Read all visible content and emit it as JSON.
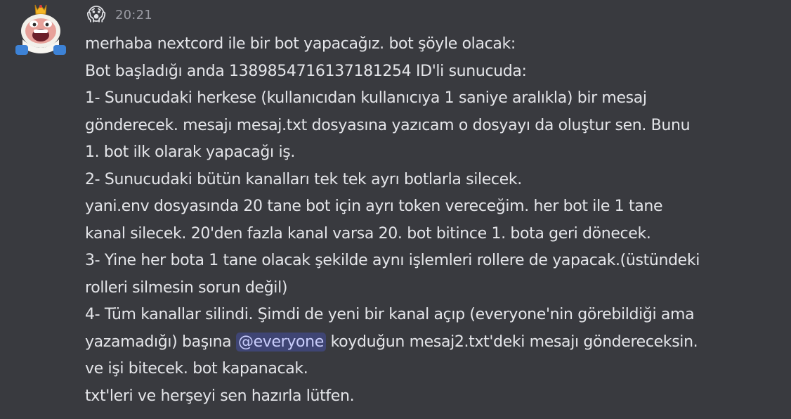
{
  "author": {
    "badge_emoji": "😱",
    "avatar_icon": "king-emote-avatar-icon"
  },
  "timestamp": "20:21",
  "message": {
    "lines": [
      "merhaba nextcord ile bir bot yapacağız. bot şöyle olacak:",
      "Bot başladığı anda 1389854716137181254 ID'li sunucuda:",
      "1- Sunucudaki herkese (kullanıcıdan kullanıcıya 1 saniye aralıkla) bir mesaj",
      "gönderecek. mesajı mesaj.txt dosyasına yazıcam o dosyayı da oluştur sen. Bunu",
      "1. bot ilk olarak yapacağı iş.",
      "2- Sunucudaki bütün kanalları tek tek ayrı botlarla silecek.",
      "yani.env dosyasında 20 tane bot için ayrı token vereceğim. her bot ile 1 tane",
      "kanal silecek. 20'den fazla kanal varsa 20. bot bitince 1. bota geri dönecek.",
      "3- Yine her bota 1 tane olacak şekilde aynı işlemleri rollere de yapacak.(üstündeki",
      "rolleri silmesin sorun değil)",
      "4- Tüm kanallar silindi. Şimdi de yeni bir kanal açıp (everyone'nin görebildiği ama"
    ],
    "mention_line": {
      "before": "yazamadığı) başına ",
      "mention": "@everyone",
      "after": " koyduğun mesaj2.txt'deki mesajı göndereceksin."
    },
    "tail_lines": [
      "ve işi bitecek. bot kapanacak.",
      "txt'leri ve herşeyi sen hazırla lütfen."
    ]
  },
  "colors": {
    "background": "#393a3f",
    "text": "#e4e5e9",
    "timestamp": "#9a9ba3",
    "mention_bg": "#3f4574",
    "mention_text": "#c9cdfb"
  }
}
